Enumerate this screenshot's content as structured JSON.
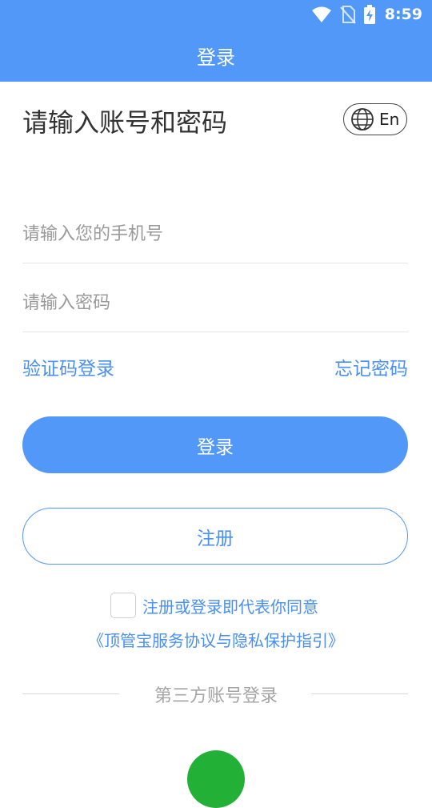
{
  "status_bar": {
    "time": "8:59",
    "icons": [
      "wifi-icon",
      "no-sim-icon",
      "battery-charging-icon"
    ]
  },
  "app_bar": {
    "title": "登录"
  },
  "main": {
    "heading": "请输入账号和密码",
    "language_button": {
      "icon": "globe-icon",
      "label": "En"
    },
    "phone_input": {
      "value": "",
      "placeholder": "请输入您的手机号"
    },
    "password_input": {
      "value": "",
      "placeholder": "请输入密码"
    },
    "sms_login_link": "验证码登录",
    "forgot_password_link": "忘记密码",
    "login_button": "登录",
    "register_button": "注册",
    "agreement": {
      "checked": false,
      "text": "注册或登录即代表你同意",
      "link": "《顶管宝服务协议与隐私保护指引》"
    },
    "third_party": {
      "label": "第三方账号登录",
      "icon": "wechat-icon"
    }
  },
  "colors": {
    "primary": "#5298f9",
    "link": "#4a8ff5",
    "wechat": "#22b036"
  }
}
